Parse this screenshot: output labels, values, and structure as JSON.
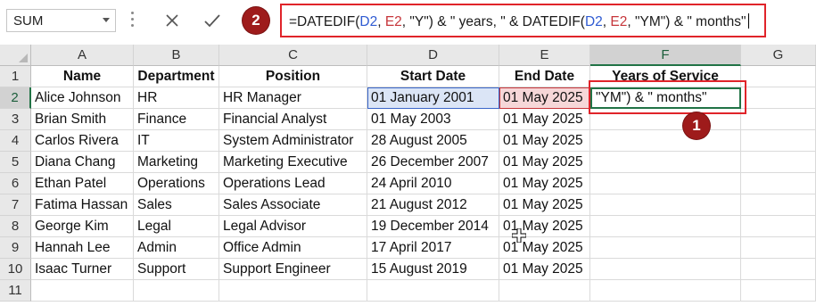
{
  "formula_bar": {
    "name_box": "SUM",
    "formula_parts": [
      {
        "text": "=DATEDIF(",
        "kind": "plain"
      },
      {
        "text": "D2",
        "kind": "ref-d"
      },
      {
        "text": ", ",
        "kind": "plain"
      },
      {
        "text": "E2",
        "kind": "ref-e"
      },
      {
        "text": ", \"Y\") & \" years, \" & DATEDIF(",
        "kind": "plain"
      },
      {
        "text": "D2",
        "kind": "ref-d"
      },
      {
        "text": ", ",
        "kind": "plain"
      },
      {
        "text": "E2",
        "kind": "ref-e"
      },
      {
        "text": ", \"YM\") & \" months\"",
        "kind": "plain"
      }
    ],
    "badge_number": "2"
  },
  "cell_badge_number": "1",
  "columns": [
    "A",
    "B",
    "C",
    "D",
    "E",
    "F",
    "G"
  ],
  "rows": [
    "1",
    "2",
    "3",
    "4",
    "5",
    "6",
    "7",
    "8",
    "9",
    "10",
    "11"
  ],
  "headers": [
    "Name",
    "Department",
    "Position",
    "Start Date",
    "End Date",
    "Years of Service"
  ],
  "data_rows": [
    [
      "Alice Johnson",
      "HR",
      "HR Manager",
      "01 January 2001",
      "01 May 2025",
      "\"YM\") & \" months\""
    ],
    [
      "Brian Smith",
      "Finance",
      "Financial Analyst",
      "01 May 2003",
      "01 May 2025",
      ""
    ],
    [
      "Carlos Rivera",
      "IT",
      "System Administrator",
      "28 August 2005",
      "01 May 2025",
      ""
    ],
    [
      "Diana Chang",
      "Marketing",
      "Marketing Executive",
      "26 December 2007",
      "01 May 2025",
      ""
    ],
    [
      "Ethan Patel",
      "Operations",
      "Operations Lead",
      "24 April 2010",
      "01 May 2025",
      ""
    ],
    [
      "Fatima Hassan",
      "Sales",
      "Sales Associate",
      "21 August 2012",
      "01 May 2025",
      ""
    ],
    [
      "George Kim",
      "Legal",
      "Legal Advisor",
      "19 December 2014",
      "01 May 2025",
      ""
    ],
    [
      "Hannah Lee",
      "Admin",
      "Office Admin",
      "17 April 2017",
      "01 May 2025",
      ""
    ],
    [
      "Isaac Turner",
      "Support",
      "Support Engineer",
      "15 August 2019",
      "01 May 2025",
      ""
    ]
  ],
  "colors": {
    "accent_green": "#217346",
    "highlight_red": "#e0242a",
    "badge_red": "#9e1b1b",
    "ref_blue": "#2f5bd2",
    "ref_red": "#c6363b"
  }
}
